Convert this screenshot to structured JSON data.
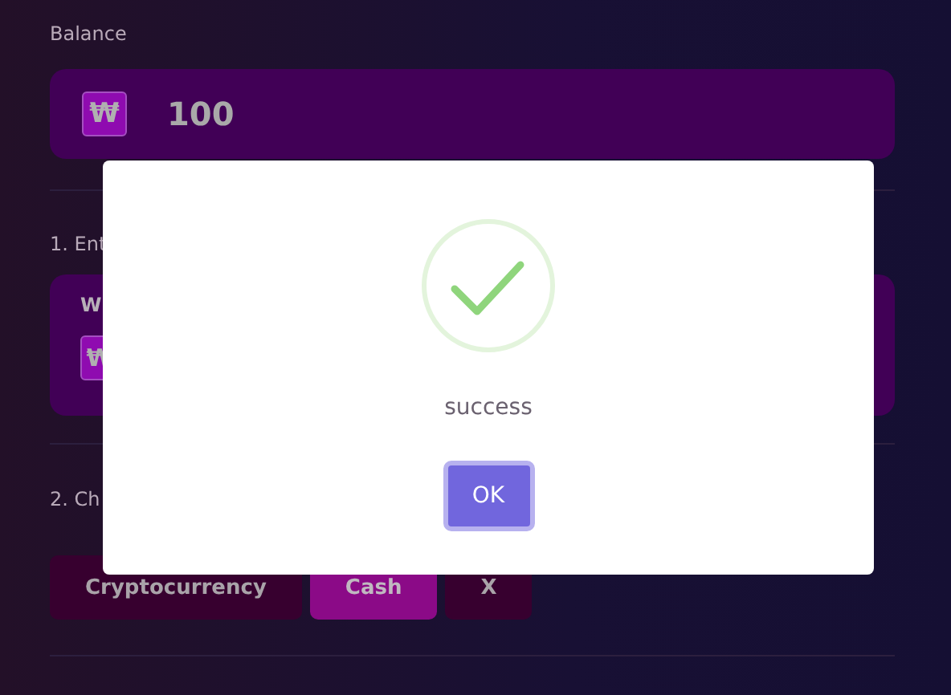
{
  "balance": {
    "label": "Balance",
    "currency_symbol": "₩",
    "amount": "100"
  },
  "step_1": {
    "label": "1. Ent",
    "card_title": "W",
    "currency_symbol": "₩"
  },
  "step_2": {
    "label": "2. Ch",
    "options": [
      {
        "label": "Cryptocurrency",
        "selected": false
      },
      {
        "label": "Cash",
        "selected": true
      },
      {
        "label": "X",
        "selected": false
      }
    ]
  },
  "dialog": {
    "message": "success",
    "button": "OK"
  }
}
